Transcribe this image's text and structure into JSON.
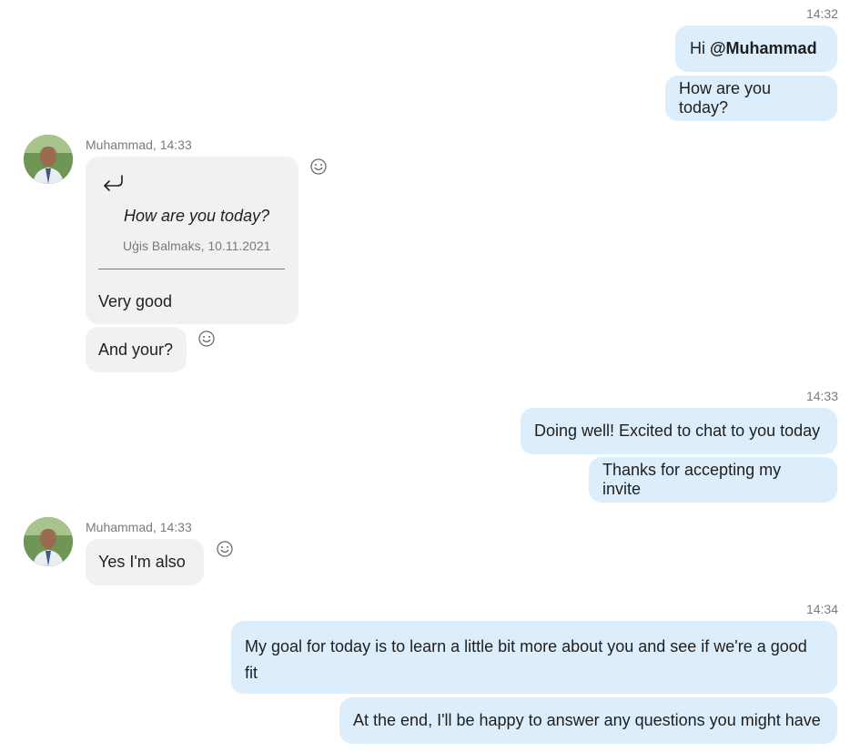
{
  "groups": {
    "out1": {
      "time": "14:32",
      "messages": [
        {
          "prefix": "Hi ",
          "mention": "@Muhammad"
        },
        {
          "text": "How are you today?"
        }
      ]
    },
    "in1": {
      "sender": "Muhammad, 14:33",
      "quote": {
        "text": "How are you today?",
        "meta": "Uģis Balmaks, 10.11.2021"
      },
      "reply": "Very good",
      "second": "And your?"
    },
    "out2": {
      "time": "14:33",
      "messages": [
        "Doing well! Excited to chat to you today",
        "Thanks for accepting my invite"
      ]
    },
    "in2": {
      "sender": "Muhammad, 14:33",
      "message": "Yes I'm also"
    },
    "out3": {
      "time": "14:34",
      "messages": [
        "My goal for today is to learn a little bit more about you and see if we're a good fit",
        "At the end, I'll be happy to answer any questions you might have"
      ]
    }
  },
  "icons": {
    "avatar": "user-avatar",
    "reply_arrow": "reply-arrow-icon",
    "emoji": "emoji-reaction-icon"
  },
  "colors": {
    "outgoing_bubble": "#dcedfb",
    "incoming_bubble": "#f1f1f4",
    "timestamp": "#7a7a7a"
  }
}
